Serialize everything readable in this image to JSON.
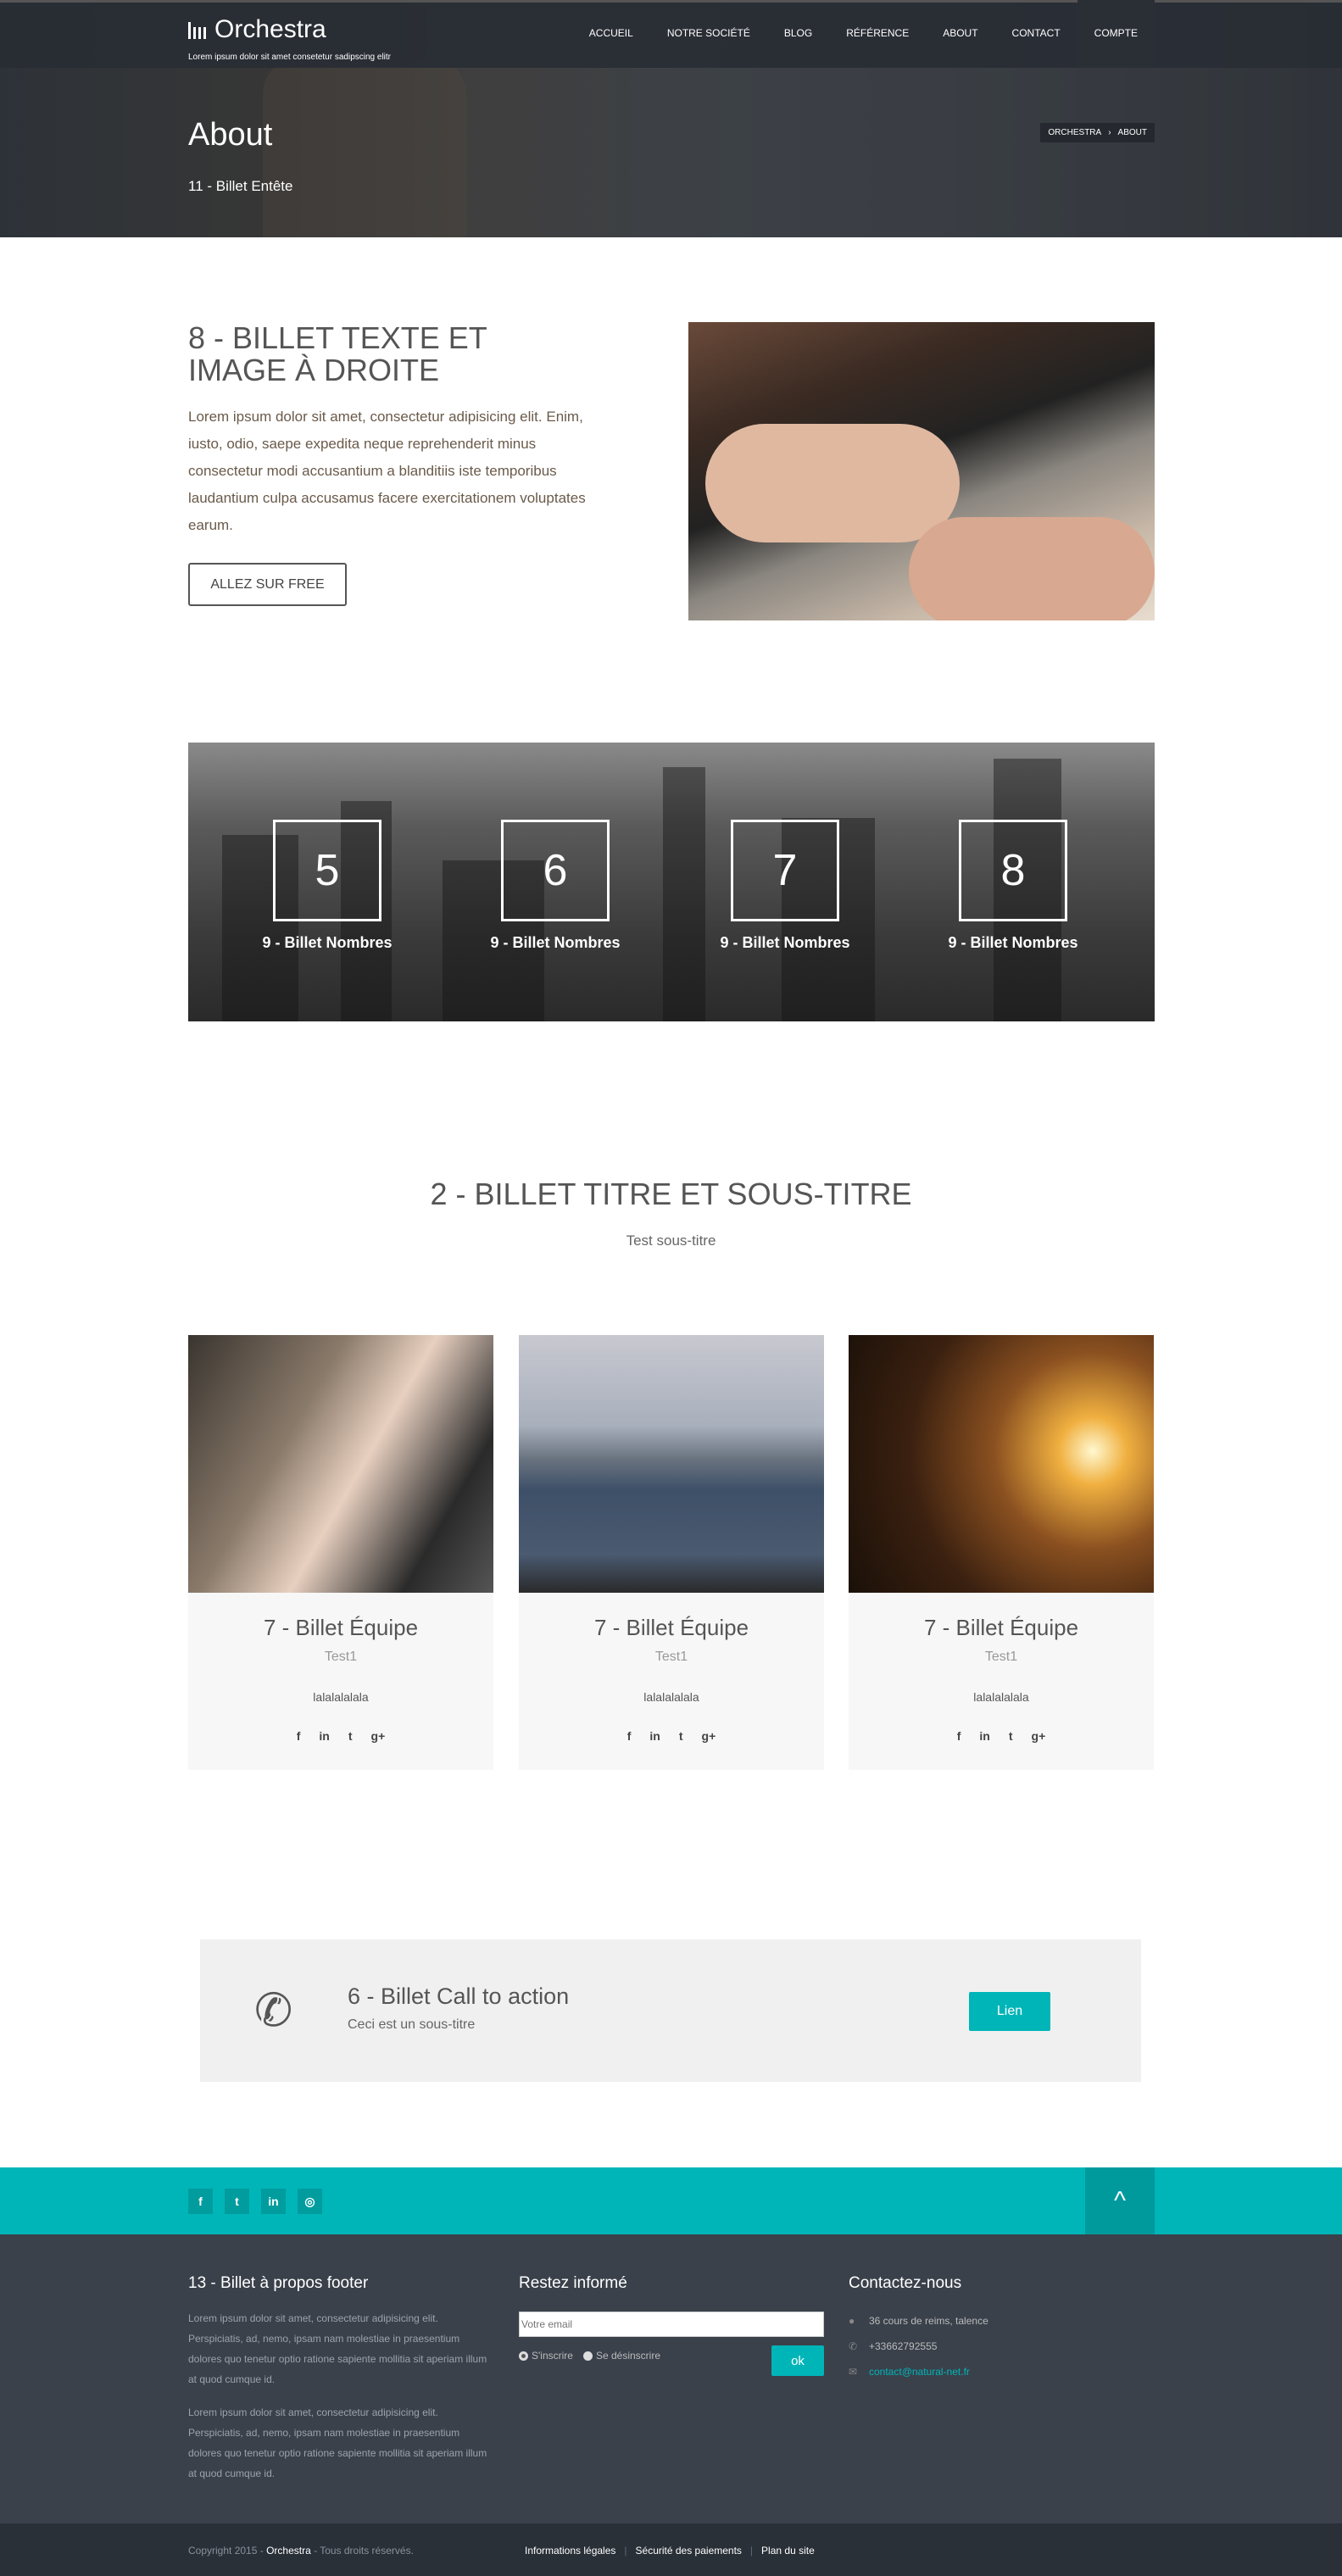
{
  "header": {
    "brand": "Orchestra",
    "tagline": "Lorem ipsum dolor sit amet consetetur sadipscing elitr",
    "nav": [
      "ACCUEIL",
      "NOTRE SOCIÉTÉ",
      "BLOG",
      "RÉFÉRENCE",
      "ABOUT",
      "CONTACT",
      "COMPTE"
    ],
    "active_nav": "COMPTE"
  },
  "hero": {
    "title": "About",
    "subtitle": "11 - Billet Entête",
    "breadcrumb": [
      "ORCHESTRA",
      "ABOUT"
    ]
  },
  "text_image": {
    "title": "8 - BILLET TEXTE ET IMAGE À DROITE",
    "body": "Lorem ipsum dolor sit amet, consectetur adipisicing elit. Enim, iusto, odio, saepe expedita neque reprehenderit minus consectetur modi accusantium a blanditiis iste temporibus laudantium culpa accusamus facere exercitationem voluptates earum.",
    "button": "ALLEZ SUR FREE"
  },
  "stats": [
    {
      "value": "5",
      "label": "9 - Billet Nombres"
    },
    {
      "value": "6",
      "label": "9 - Billet Nombres"
    },
    {
      "value": "7",
      "label": "9 - Billet Nombres"
    },
    {
      "value": "8",
      "label": "9 - Billet Nombres"
    }
  ],
  "title_section": {
    "title": "2 - BILLET TITRE ET SOUS-TITRE",
    "subtitle": "Test sous-titre"
  },
  "team": [
    {
      "name": "7 - Billet Équipe",
      "role": "Test1",
      "desc": "lalalalalala"
    },
    {
      "name": "7 - Billet Équipe",
      "role": "Test1",
      "desc": "lalalalalala"
    },
    {
      "name": "7 - Billet Équipe",
      "role": "Test1",
      "desc": "lalalalalala"
    }
  ],
  "team_social": [
    "facebook-icon",
    "linkedin-icon",
    "twitter-icon",
    "google-plus-icon"
  ],
  "cta": {
    "title": "6 - Billet Call to action",
    "subtitle": "Ceci est un sous-titre",
    "button": "Lien",
    "icon": "phone-icon"
  },
  "social_bar": [
    "facebook-icon",
    "twitter-icon",
    "linkedin-icon",
    "dribbble-icon"
  ],
  "footer": {
    "about_title": "13 - Billet à propos footer",
    "about_p1": "Lorem ipsum dolor sit amet, consectetur adipisicing elit. Perspiciatis, ad, nemo, ipsam nam molestiae in praesentium dolores quo tenetur optio ratione sapiente mollitia sit aperiam illum at quod cumque id.",
    "about_p2": "Lorem ipsum dolor sit amet, consectetur adipisicing elit. Perspiciatis, ad, nemo, ipsam nam molestiae in praesentium dolores quo tenetur optio ratione sapiente mollitia sit aperiam illum at quod cumque id.",
    "news_title": "Restez informé",
    "email_placeholder": "Votre email",
    "subscribe": "S'inscrire",
    "unsubscribe": "Se désinscrire",
    "ok": "ok",
    "contact_title": "Contactez-nous",
    "address": "36 cours de reims, talence",
    "phone": "+33662792555",
    "email": "contact@natural-net.fr",
    "copyright_pre": "Copyright 2015 - ",
    "copyright_brand": "Orchestra",
    "copyright_post": " - Tous droits réservés.",
    "links": [
      "Informations légales",
      "Sécurité des paiements",
      "Plan du site"
    ]
  },
  "colors": {
    "accent": "#00b5b8",
    "footer_bg": "#3a414b",
    "bottom_bg": "#2a3038"
  }
}
